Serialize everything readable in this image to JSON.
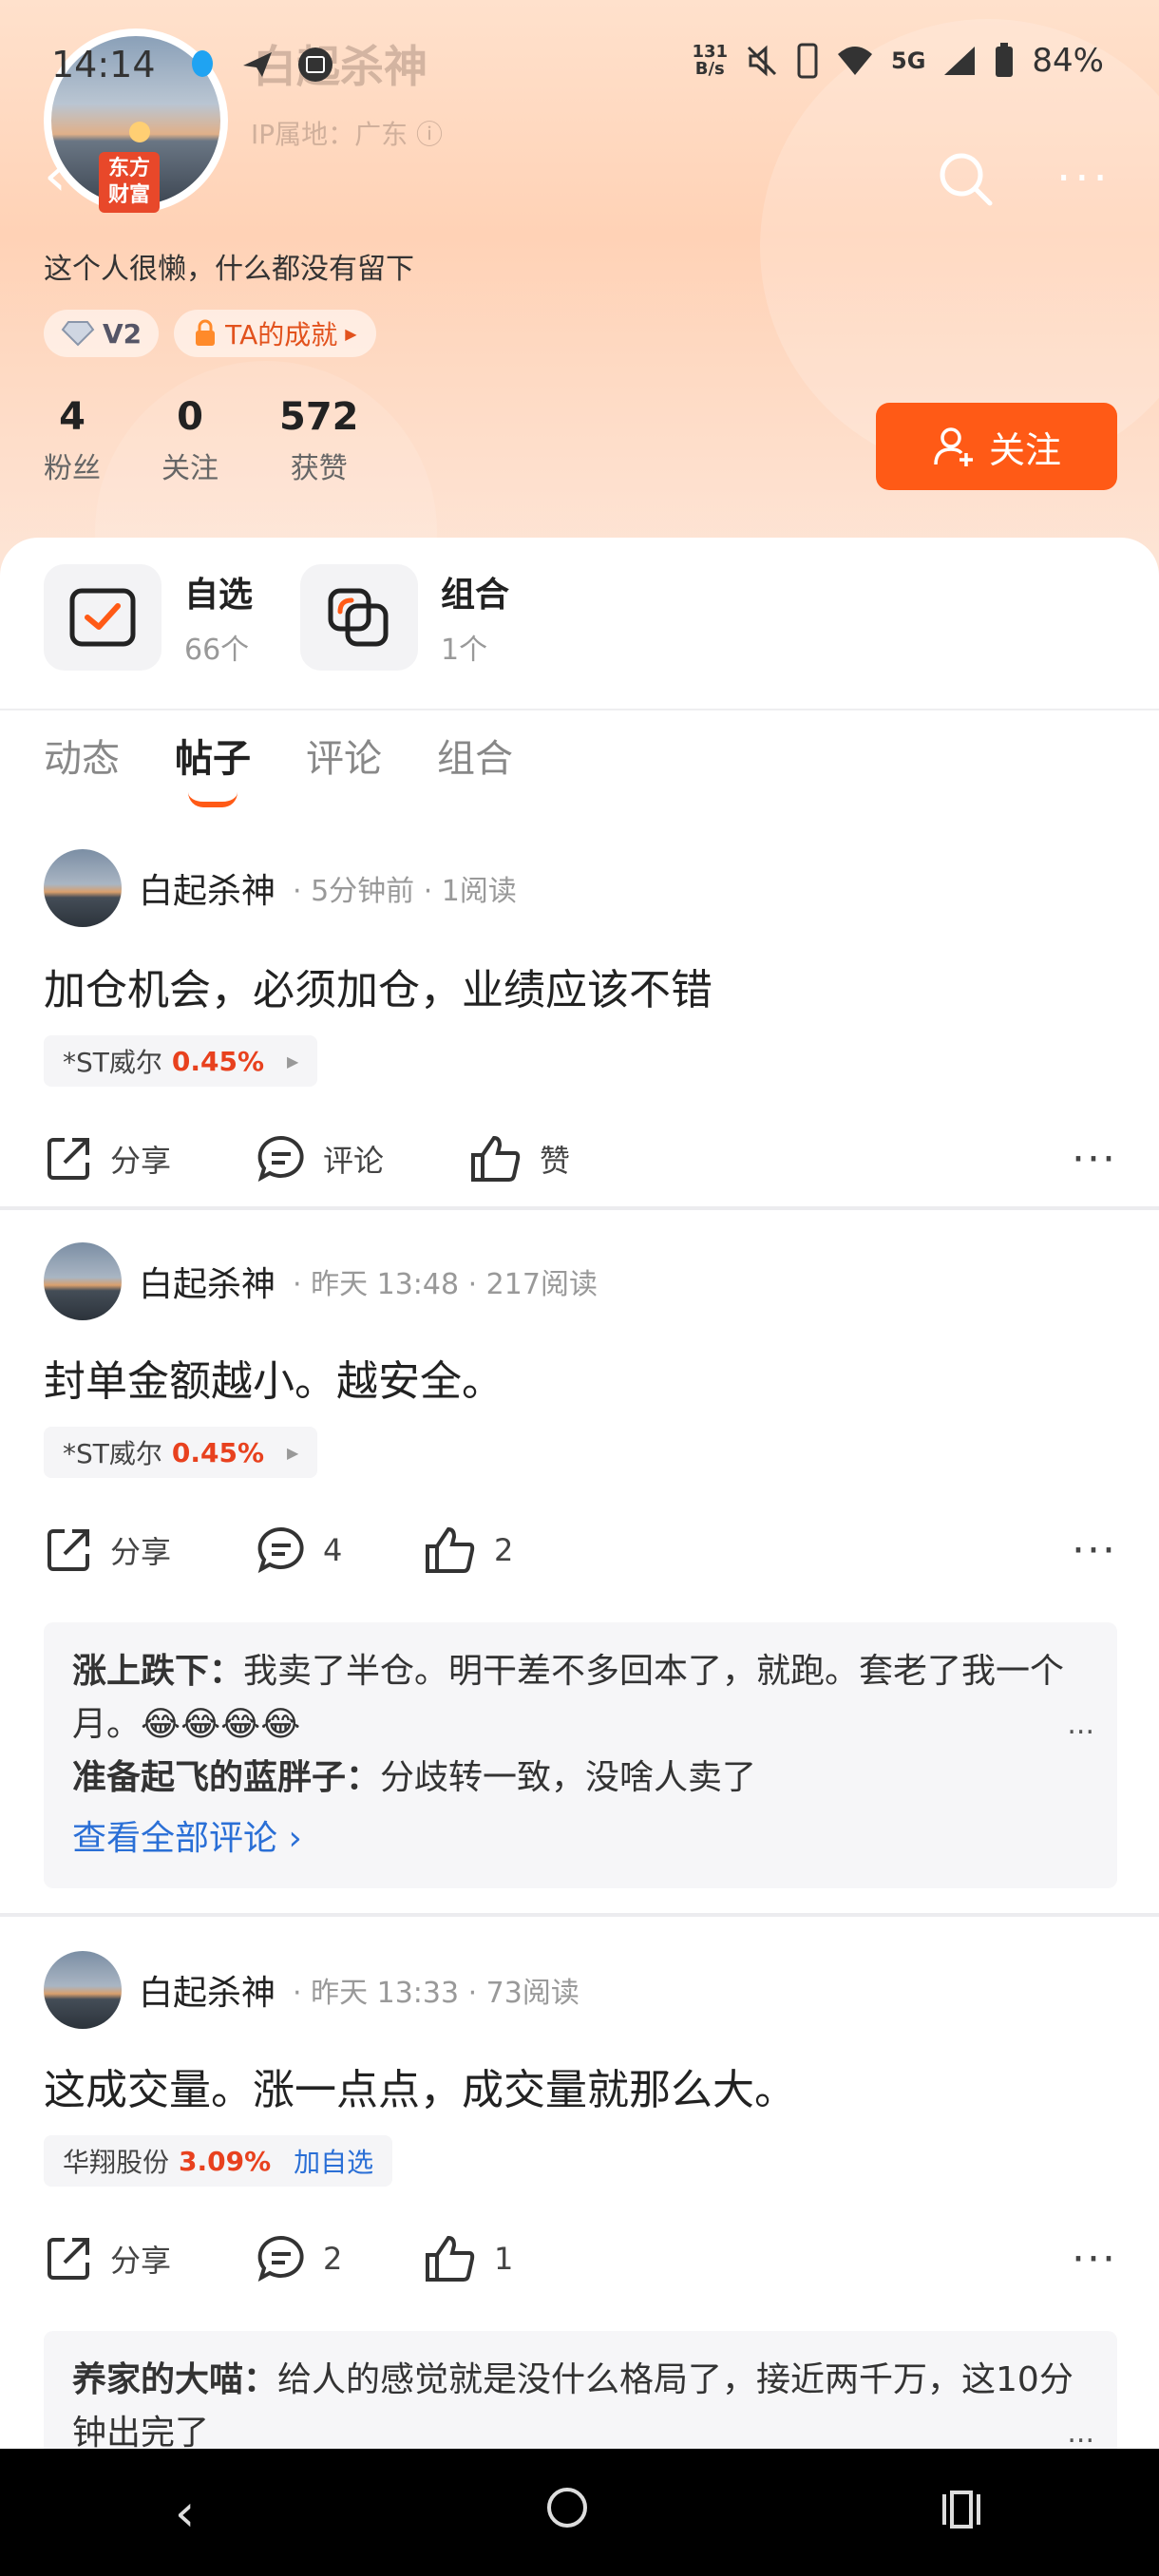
{
  "status_bar": {
    "time": "14:14",
    "net_speed_top": "131",
    "net_speed_unit": "B/s",
    "network": "5G",
    "battery": "84%"
  },
  "profile": {
    "name": "白起杀神",
    "ip_location": "IP属地：广东",
    "brand_badge": "东方\n财富",
    "bio": "这个人很懒，什么都没有留下",
    "level_badge": "V2",
    "achievement_badge": "TA的成就",
    "stats": [
      {
        "value": "4",
        "label": "粉丝"
      },
      {
        "value": "0",
        "label": "关注"
      },
      {
        "value": "572",
        "label": "获赞"
      }
    ],
    "follow_label": "关注"
  },
  "shortcuts": [
    {
      "title": "自选",
      "sub": "66个",
      "icon": "watchlist-check-icon"
    },
    {
      "title": "组合",
      "sub": "1个",
      "icon": "portfolio-icon"
    }
  ],
  "tabs": [
    {
      "label": "动态",
      "active": false
    },
    {
      "label": "帖子",
      "active": true
    },
    {
      "label": "评论",
      "active": false
    },
    {
      "label": "组合",
      "active": false
    }
  ],
  "posts": [
    {
      "author": "白起杀神",
      "meta": "· 5分钟前 · 1阅读",
      "text": "加仓机会，必须加仓，业绩应该不错",
      "stock": {
        "name": "*ST威尔",
        "change": "0.45%",
        "add": ""
      },
      "share_label": "分享",
      "comment_label": "评论",
      "like_label": "赞"
    },
    {
      "author": "白起杀神",
      "meta": "· 昨天 13:48 · 217阅读",
      "text": "封单金额越小。越安全。",
      "stock": {
        "name": "*ST威尔",
        "change": "0.45%",
        "add": ""
      },
      "share_label": "分享",
      "comment_label": "4",
      "like_label": "2",
      "comments": [
        {
          "user": "涨上跌下：",
          "text": "我卖了半仓。明干差不多回本了，就跑。套老了我一个月。😂😂😂😂"
        },
        {
          "user": "准备起飞的蓝胖子：",
          "text": "分歧转一致，没啥人卖了"
        }
      ],
      "view_all": "查看全部评论 ›"
    },
    {
      "author": "白起杀神",
      "meta": "· 昨天 13:33 · 73阅读",
      "text": "这成交量。涨一点点，成交量就那么大。",
      "stock": {
        "name": "华翔股份",
        "change": "3.09%",
        "add": "加自选"
      },
      "share_label": "分享",
      "comment_label": "2",
      "like_label": "1",
      "comments": [
        {
          "user": "养家的大喵：",
          "text": "给人的感觉就是没什么格局了，接近两千万，这10分钟出完了"
        }
      ]
    }
  ],
  "colors": {
    "accent": "#ff5a16",
    "up": "#e8411e",
    "link": "#2a6fd6"
  }
}
